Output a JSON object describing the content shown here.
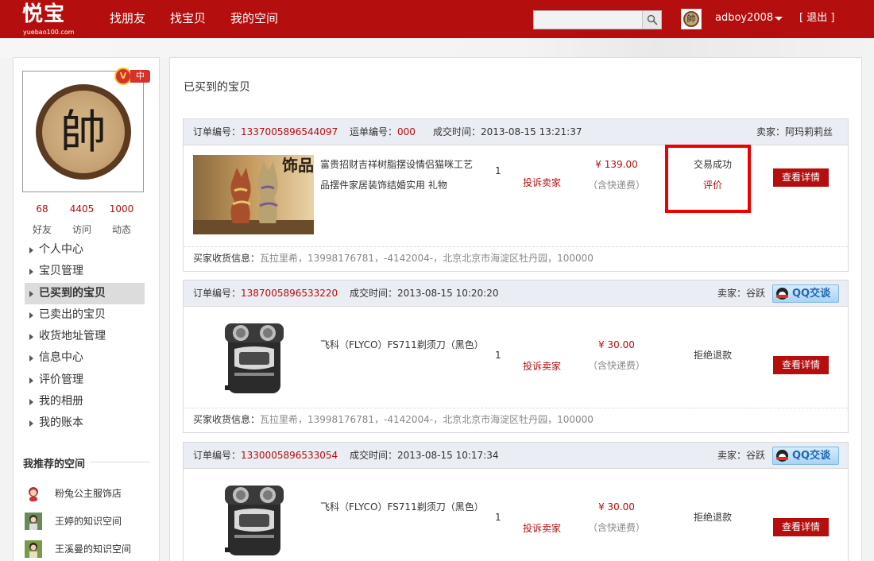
{
  "header": {
    "logo_text": "悦宝",
    "logo_domain": "yuebao100.com",
    "nav": [
      "找朋友",
      "找宝贝",
      "我的空间"
    ],
    "search": {
      "value": "",
      "placeholder": ""
    },
    "user_avatar_char": "帥",
    "username": "adboy2008",
    "logout": "[ 退出 ]"
  },
  "sidebar": {
    "avatar_char": "帥",
    "badge": {
      "v": "V",
      "level": "中"
    },
    "stats": [
      {
        "value": "68",
        "label": "好友"
      },
      {
        "value": "4405",
        "label": "访问"
      },
      {
        "value": "1000",
        "label": "动态"
      }
    ],
    "menu": [
      "个人中心",
      "宝贝管理",
      "已买到的宝贝",
      "已卖出的宝贝",
      "收货地址管理",
      "信息中心",
      "评价管理",
      "我的相册",
      "我的账本"
    ],
    "active_index": 2,
    "recommend_title": "我推荐的空间",
    "recommend": [
      "粉兔公主服饰店",
      "王婷的知识空间",
      "王溪曼的知识空间"
    ]
  },
  "main": {
    "title": "已买到的宝贝",
    "labels": {
      "order_no": "订单编号：",
      "ship_no": "运单编号：",
      "deal_time": "成交时间：",
      "seller": "卖家：",
      "buyer_addr": "买家收货信息：",
      "complain": "投诉卖家",
      "detail": "查看详情",
      "qq": "QQ交谈",
      "shipping_incl": "（含快递费）"
    },
    "orders": [
      {
        "order_no": "1337005896544097",
        "ship_no": "000",
        "time": "2013-08-15 13:21:37",
        "seller": "阿玛莉莉丝",
        "product": "富贵招财吉祥树脂摆设情侣猫咪工艺品摆件家居装饰结婚实用 礼物",
        "qty": "1",
        "price": "¥ 139.00",
        "status": "交易成功",
        "status_link": "评价",
        "address": "瓦拉里希，13998176781，-4142004-，北京北京市海淀区牡丹园，100000"
      },
      {
        "order_no": "1387005896533220",
        "time": "2013-08-15 10:20:20",
        "seller": "谷跃",
        "product": "飞科（FLYCO）FS711剃须刀（黑色）",
        "qty": "1",
        "price": "¥ 30.00",
        "status": "拒绝退款",
        "address": "瓦拉里希，13998176781，-4142004-，北京北京市海淀区牡丹园，100000"
      },
      {
        "order_no": "1330005896533054",
        "time": "2013-08-15 10:17:34",
        "seller": "谷跃",
        "product": "飞科（FLYCO）FS711剃须刀（黑色）",
        "qty": "1",
        "price": "¥ 30.00",
        "status": "拒绝退款"
      }
    ]
  },
  "colors": {
    "brand_red": "#b50e0e",
    "highlight_red": "#e00000",
    "order_head_bg": "#eaedf3"
  }
}
